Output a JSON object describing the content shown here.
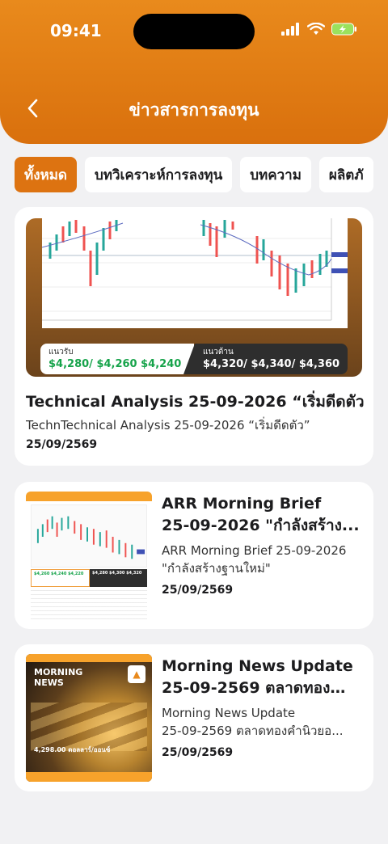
{
  "status_bar": {
    "time": "09:41"
  },
  "header": {
    "title": "ข่าวสารการลงทุน"
  },
  "tabs": [
    {
      "label": "ทั้งหมด",
      "active": true
    },
    {
      "label": "บทวิเคราะห์การลงทุน",
      "active": false
    },
    {
      "label": "บทความ",
      "active": false
    },
    {
      "label": "ผลิตภั",
      "active": false
    }
  ],
  "articles": [
    {
      "title": "Technical Analysis 25-09-2026 “เริ่มดีดตัว”",
      "description": "TechnTechnical Analysis 25-09-2026 “เริ่มดีดตัว”",
      "date": "25/09/2569",
      "thumbnail": {
        "support_label": "แนวรับ",
        "support_values": "$4,280/ $4,260 $4,240",
        "resistance_label": "แนวต้าน",
        "resistance_values": "$4,320/ $4,340/ $4,360"
      }
    },
    {
      "title_line1": "ARR Morning Brief",
      "title_line2": "25-09-2026 \"กำลังสร้าง...",
      "description_line1": "ARR Morning Brief 25-09-2026",
      "description_line2": "\"กำลังสร้างฐานใหม่\"",
      "date": "25/09/2569",
      "thumbnail": {
        "support_values": "$4,260 $4,240 $4,220",
        "resistance_values": "$4,280 $4,300 $4,320"
      }
    },
    {
      "title_line1": "Morning News Update",
      "title_line2": "25-09-2569 ตลาดทองคำ...",
      "description_line1": "Morning News Update",
      "description_line2": "25-09-2569 ตลาดทองคำนิวยอ...",
      "date": "25/09/2569",
      "thumbnail": {
        "heading": "MORNING NEWS",
        "price": "4,298.00 ดอลลาร์/ออนซ์"
      }
    }
  ],
  "colors": {
    "accent": "#dd7311",
    "header": "#e98a1c",
    "support_green": "#16a34a"
  }
}
